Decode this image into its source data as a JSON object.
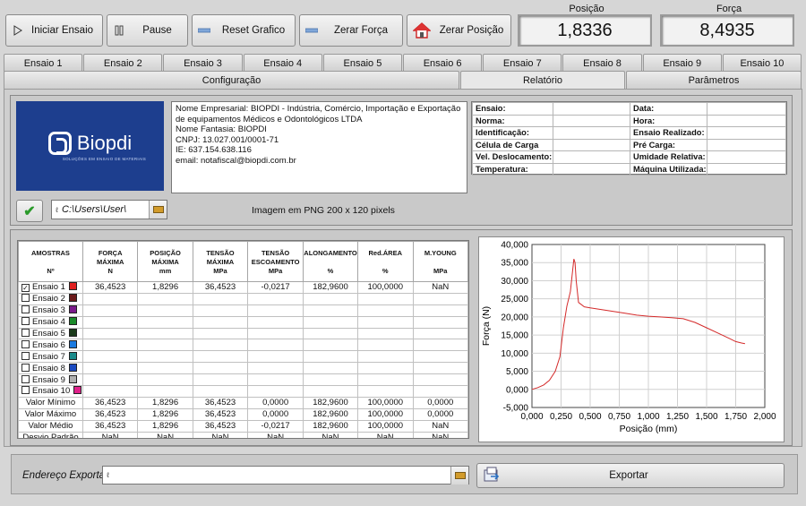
{
  "toolbar": {
    "start": "Iniciar Ensaio",
    "pause": "Pause",
    "reset_graph": "Reset Grafico",
    "zero_force": "Zerar Força",
    "zero_position": "Zerar Posição"
  },
  "readouts": {
    "position_label": "Posição",
    "position_value": "1,8336",
    "force_label": "Força",
    "force_value": "8,4935"
  },
  "tabs_row1": [
    "Ensaio 1",
    "Ensaio 2",
    "Ensaio 3",
    "Ensaio 4",
    "Ensaio 5",
    "Ensaio 6",
    "Ensaio 7",
    "Ensaio 8",
    "Ensaio 9",
    "Ensaio 10"
  ],
  "tabs_row2": [
    "Configuração",
    "Relatório",
    "Parâmetros"
  ],
  "active_tab": "Relatório",
  "logo": {
    "name": "Biopdi",
    "tagline": "SOLUÇÕES EM ENSAIO DE MATERIAIS"
  },
  "company": {
    "line1": "Nome Empresarial: BIOPDI - Indústria, Comércio, Importação e Exportação",
    "line2": "de equipamentos Médicos e Odontológicos LTDA",
    "line3": "Nome Fantasia: BIOPDI",
    "line4": "CNPJ: 13.027.001/0001-71",
    "line5": "IE: 637.154.638.116",
    "line6": "email: notafiscal@biopdi.com.br"
  },
  "info": {
    "left": [
      "Ensaio:",
      "Norma:",
      "Identificação:",
      "Célula de Carga",
      "Vel. Deslocamento:",
      "Temperatura:"
    ],
    "right": [
      "Data:",
      "Hora:",
      "Ensaio Realizado:",
      "Pré Carga:",
      "Umidade Relativa:",
      "Máquina Utilizada:"
    ]
  },
  "path": {
    "value": "C:\\Users\\User\\",
    "prefix": "ℓ"
  },
  "image_note": "Imagem em PNG 200 x 120 pixels",
  "table": {
    "columns": [
      {
        "line1": "AMOSTRAS",
        "line2": "",
        "line3": "Nº"
      },
      {
        "line1": "FORÇA",
        "line2": "MÁXIMA",
        "line3": "N"
      },
      {
        "line1": "POSIÇÃO",
        "line2": "MÁXIMA",
        "line3": "mm"
      },
      {
        "line1": "TENSÃO",
        "line2": "MÁXIMA",
        "line3": "MPa"
      },
      {
        "line1": "TENSÃO",
        "line2": "ESCOAMENTO",
        "line3": "MPa"
      },
      {
        "line1": "ALONGAMENTO",
        "line2": "",
        "line3": "%"
      },
      {
        "line1": "Red.ÁREA",
        "line2": "",
        "line3": "%"
      },
      {
        "line1": "M.YOUNG",
        "line2": "",
        "line3": "MPa"
      }
    ],
    "samples": [
      {
        "name": "Ensaio 1",
        "checked": true,
        "color": "#e02020",
        "values": [
          "36,4523",
          "1,8296",
          "36,4523",
          "-0,0217",
          "182,9600",
          "100,0000",
          "NaN"
        ]
      },
      {
        "name": "Ensaio 2",
        "checked": false,
        "color": "#6b1a1a",
        "values": [
          "",
          "",
          "",
          "",
          "",
          "",
          ""
        ]
      },
      {
        "name": "Ensaio 3",
        "checked": false,
        "color": "#7a1a8a",
        "values": [
          "",
          "",
          "",
          "",
          "",
          "",
          ""
        ]
      },
      {
        "name": "Ensaio 4",
        "checked": false,
        "color": "#1a8a2a",
        "values": [
          "",
          "",
          "",
          "",
          "",
          "",
          ""
        ]
      },
      {
        "name": "Ensaio 5",
        "checked": false,
        "color": "#1a3a1a",
        "values": [
          "",
          "",
          "",
          "",
          "",
          "",
          ""
        ]
      },
      {
        "name": "Ensaio 6",
        "checked": false,
        "color": "#1a7ae0",
        "values": [
          "",
          "",
          "",
          "",
          "",
          "",
          ""
        ]
      },
      {
        "name": "Ensaio 7",
        "checked": false,
        "color": "#1a8a8a",
        "values": [
          "",
          "",
          "",
          "",
          "",
          "",
          ""
        ]
      },
      {
        "name": "Ensaio 8",
        "checked": false,
        "color": "#1a4ac0",
        "values": [
          "",
          "",
          "",
          "",
          "",
          "",
          ""
        ]
      },
      {
        "name": "Ensaio 9",
        "checked": false,
        "color": "#b0b0b0",
        "values": [
          "",
          "",
          "",
          "",
          "",
          "",
          ""
        ]
      },
      {
        "name": "Ensaio 10",
        "checked": false,
        "color": "#e0208a",
        "values": [
          "",
          "",
          "",
          "",
          "",
          "",
          ""
        ]
      }
    ],
    "stats": [
      {
        "name": "Valor Mínimo",
        "values": [
          "36,4523",
          "1,8296",
          "36,4523",
          "0,0000",
          "182,9600",
          "100,0000",
          "0,0000"
        ]
      },
      {
        "name": "Valor Máximo",
        "values": [
          "36,4523",
          "1,8296",
          "36,4523",
          "0,0000",
          "182,9600",
          "100,0000",
          "0,0000"
        ]
      },
      {
        "name": "Valor Médio",
        "values": [
          "36,4523",
          "1,8296",
          "36,4523",
          "-0,0217",
          "182,9600",
          "100,0000",
          "NaN"
        ]
      },
      {
        "name": "Desvio Padrão",
        "values": [
          "NaN",
          "NaN",
          "NaN",
          "NaN",
          "NaN",
          "NaN",
          "NaN"
        ]
      }
    ]
  },
  "chart_data": {
    "type": "line",
    "xlabel": "Posição (mm)",
    "ylabel": "Força (N)",
    "xlim": [
      0,
      2
    ],
    "ylim": [
      -5,
      40
    ],
    "x_ticks": [
      "0,000",
      "0,250",
      "0,500",
      "0,750",
      "1,000",
      "1,250",
      "1,500",
      "1,750",
      "2,000"
    ],
    "y_ticks": [
      "-5,000",
      "0,000",
      "5,000",
      "10,000",
      "15,000",
      "20,000",
      "25,000",
      "30,000",
      "35,000",
      "40,000"
    ],
    "grid": true,
    "series": [
      {
        "color": "#d42a2a",
        "x": [
          0.0,
          0.05,
          0.1,
          0.15,
          0.2,
          0.24,
          0.27,
          0.3,
          0.33,
          0.35,
          0.36,
          0.37,
          0.38,
          0.4,
          0.45,
          0.5,
          0.6,
          0.7,
          0.8,
          0.9,
          1.0,
          1.1,
          1.2,
          1.3,
          1.4,
          1.5,
          1.6,
          1.7,
          1.75,
          1.8,
          1.83
        ],
        "y": [
          0.0,
          0.5,
          1.2,
          2.5,
          5.0,
          9.0,
          17.0,
          23.0,
          27.0,
          33.0,
          36.0,
          35.0,
          30.0,
          24.0,
          22.8,
          22.5,
          22.0,
          21.5,
          21.0,
          20.5,
          20.2,
          20.0,
          19.8,
          19.5,
          18.5,
          17.0,
          15.5,
          14.0,
          13.2,
          12.8,
          12.6
        ]
      }
    ]
  },
  "export": {
    "label": "Endereço Exportar",
    "value": "",
    "prefix": "ℓ",
    "button": "Exportar"
  }
}
